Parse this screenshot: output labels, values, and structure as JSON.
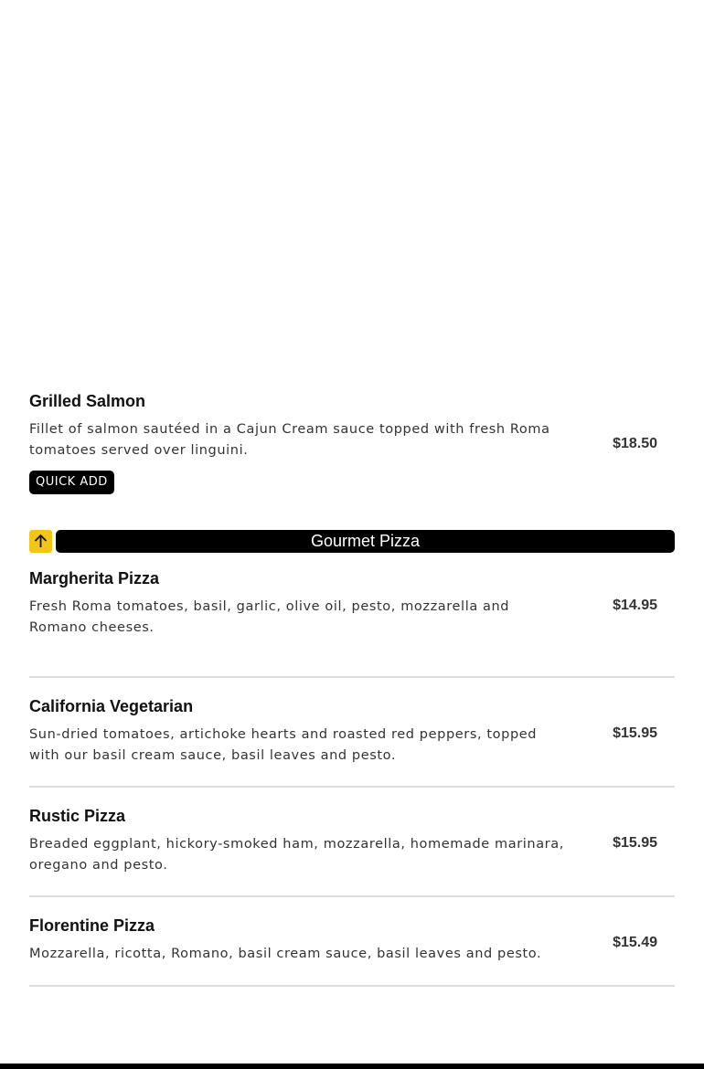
{
  "featured": {
    "name": "Grilled Salmon",
    "description": "Fillet of salmon sautéed in a Cajun Cream sauce topped with fresh Roma tomatoes served over linguini.",
    "price": "$18.50",
    "quick_add_label": "QUICK ADD"
  },
  "category": {
    "title": "Gourmet Pizza",
    "up_icon": "arrow-up-icon",
    "accent_color": "#f2c618"
  },
  "items": [
    {
      "name": "Margherita Pizza",
      "description": "Fresh Roma tomatoes, basil, garlic, olive oil, pesto, mozzarella and Romano cheeses.",
      "price": "$14.95"
    },
    {
      "name": "California Vegetarian",
      "description": "Sun-dried tomatoes, artichoke hearts and roasted red peppers, topped with our basil cream sauce, basil leaves and pesto.",
      "price": "$15.95"
    },
    {
      "name": "Rustic Pizza",
      "description": "Breaded eggplant, hickory-smoked ham, mozzarella, homemade marinara, oregano and pesto.",
      "price": "$15.95"
    },
    {
      "name": "Florentine Pizza",
      "description": "Mozzarella, ricotta, Romano, basil cream sauce, basil leaves and pesto.",
      "price": "$15.49"
    }
  ]
}
